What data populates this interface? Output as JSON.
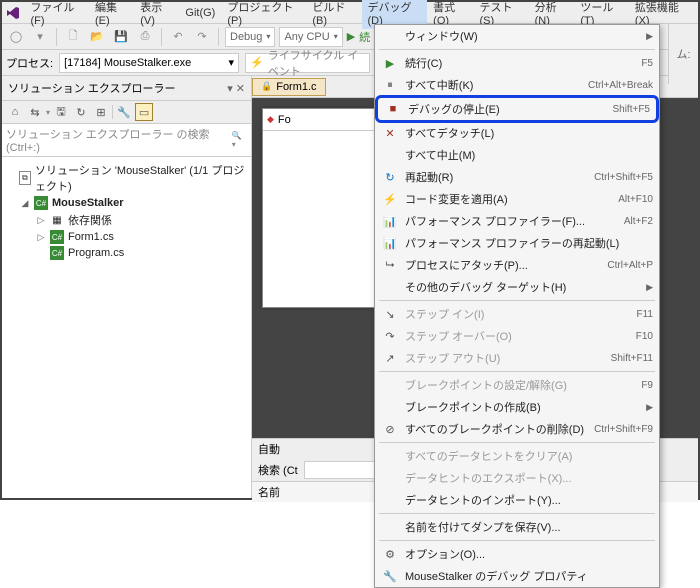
{
  "menubar": {
    "items": [
      "ファイル(F)",
      "編集(E)",
      "表示(V)",
      "Git(G)",
      "プロジェクト(P)",
      "ビルド(B)",
      "デバッグ(D)",
      "書式(O)",
      "テスト(S)",
      "分析(N)",
      "ツール(T)",
      "拡張機能(X)"
    ],
    "active_index": 6
  },
  "toolbar": {
    "config": "Debug",
    "platform": "Any CPU",
    "run_label": "続"
  },
  "processbar": {
    "label": "プロセス:",
    "process": "[17184] MouseStalker.exe",
    "lifecycle": "ライフサイクル イベント"
  },
  "solution_explorer": {
    "title": "ソリューション エクスプローラー",
    "search_placeholder": "ソリューション エクスプローラー の検索 (Ctrl+:)",
    "solution_label": "ソリューション 'MouseStalker' (1/1 プロジェクト)",
    "project": "MouseStalker",
    "nodes": [
      "依存関係",
      "Form1.cs",
      "Program.cs"
    ]
  },
  "editor_tab": "Form1.c",
  "form_title": "Fo",
  "debug_menu": {
    "items": [
      {
        "label": "ウィンドウ(W)",
        "shortcut": "",
        "submenu": true,
        "icon": ""
      },
      {
        "sep": true
      },
      {
        "label": "続行(C)",
        "shortcut": "F5",
        "icon": "▶",
        "icon_color": "#388a34"
      },
      {
        "label": "すべて中断(K)",
        "shortcut": "Ctrl+Alt+Break",
        "icon": "⏸"
      },
      {
        "label": "デバッグの停止(E)",
        "shortcut": "Shift+F5",
        "icon": "■",
        "icon_color": "#a03020",
        "highlighted": true
      },
      {
        "label": "すべてデタッチ(L)",
        "shortcut": "",
        "icon": "✕",
        "icon_color": "#a03020"
      },
      {
        "label": "すべて中止(M)",
        "shortcut": "",
        "icon": ""
      },
      {
        "label": "再起動(R)",
        "shortcut": "Ctrl+Shift+F5",
        "icon": "↻",
        "icon_color": "#1070c0"
      },
      {
        "label": "コード変更を適用(A)",
        "shortcut": "Alt+F10",
        "icon": "⚡"
      },
      {
        "label": "パフォーマンス プロファイラー(F)...",
        "shortcut": "Alt+F2",
        "icon": "📊"
      },
      {
        "label": "パフォーマンス プロファイラーの再起動(L)",
        "shortcut": "",
        "icon": "📊"
      },
      {
        "label": "プロセスにアタッチ(P)...",
        "shortcut": "Ctrl+Alt+P",
        "icon": "⮡"
      },
      {
        "label": "その他のデバッグ ターゲット(H)",
        "shortcut": "",
        "submenu": true,
        "icon": ""
      },
      {
        "sep": true
      },
      {
        "label": "ステップ イン(I)",
        "shortcut": "F11",
        "icon": "↘",
        "disabled": true
      },
      {
        "label": "ステップ オーバー(O)",
        "shortcut": "F10",
        "icon": "↷",
        "disabled": true
      },
      {
        "label": "ステップ アウト(U)",
        "shortcut": "Shift+F11",
        "icon": "↗",
        "disabled": true
      },
      {
        "sep": true
      },
      {
        "label": "ブレークポイントの設定/解除(G)",
        "shortcut": "F9",
        "icon": "",
        "disabled": true
      },
      {
        "label": "ブレークポイントの作成(B)",
        "shortcut": "",
        "submenu": true,
        "icon": ""
      },
      {
        "label": "すべてのブレークポイントの削除(D)",
        "shortcut": "Ctrl+Shift+F9",
        "icon": "⊘"
      },
      {
        "sep": true
      },
      {
        "label": "すべてのデータヒントをクリア(A)",
        "shortcut": "",
        "icon": "",
        "disabled": true
      },
      {
        "label": "データヒントのエクスポート(X)...",
        "shortcut": "",
        "icon": "",
        "disabled": true
      },
      {
        "label": "データヒントのインポート(Y)...",
        "shortcut": "",
        "icon": ""
      },
      {
        "sep": true
      },
      {
        "label": "名前を付けてダンプを保存(V)...",
        "shortcut": "",
        "icon": ""
      },
      {
        "sep": true
      },
      {
        "label": "オプション(O)...",
        "shortcut": "",
        "icon": "⚙"
      },
      {
        "label": "MouseStalker のデバッグ プロパティ",
        "shortcut": "",
        "icon": "🔧"
      }
    ]
  },
  "bottom_panel": {
    "title": "自動",
    "search_label": "検索 (Ct",
    "column1": "名前"
  },
  "right_clip": "ム:"
}
